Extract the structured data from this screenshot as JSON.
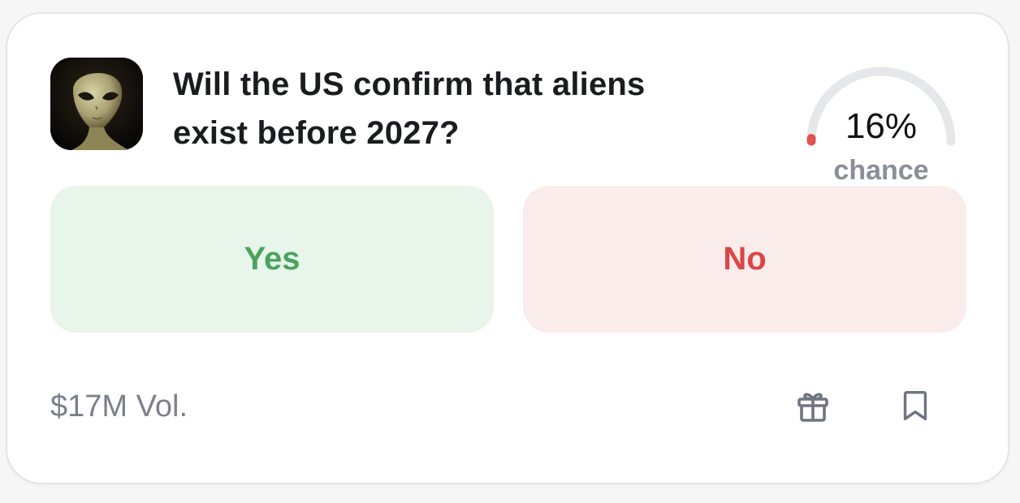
{
  "market": {
    "question": "Will the US confirm that aliens exist before 2027?",
    "thumbnail_icon": "alien-portrait",
    "chance": {
      "value": 16,
      "label_text": "16%",
      "caption": "chance",
      "color": "#e0554f"
    },
    "buttons": {
      "yes_label": "Yes",
      "no_label": "No"
    },
    "volume": "$17M Vol.",
    "actions": [
      {
        "icon": "gift-icon"
      },
      {
        "icon": "bookmark-icon"
      }
    ]
  },
  "colors": {
    "yes_bg": "#e8f5ea",
    "yes_text": "#4aa35e",
    "no_bg": "#fbecec",
    "no_text": "#d94644",
    "track": "#e6e7ea",
    "muted": "#7b808b"
  }
}
